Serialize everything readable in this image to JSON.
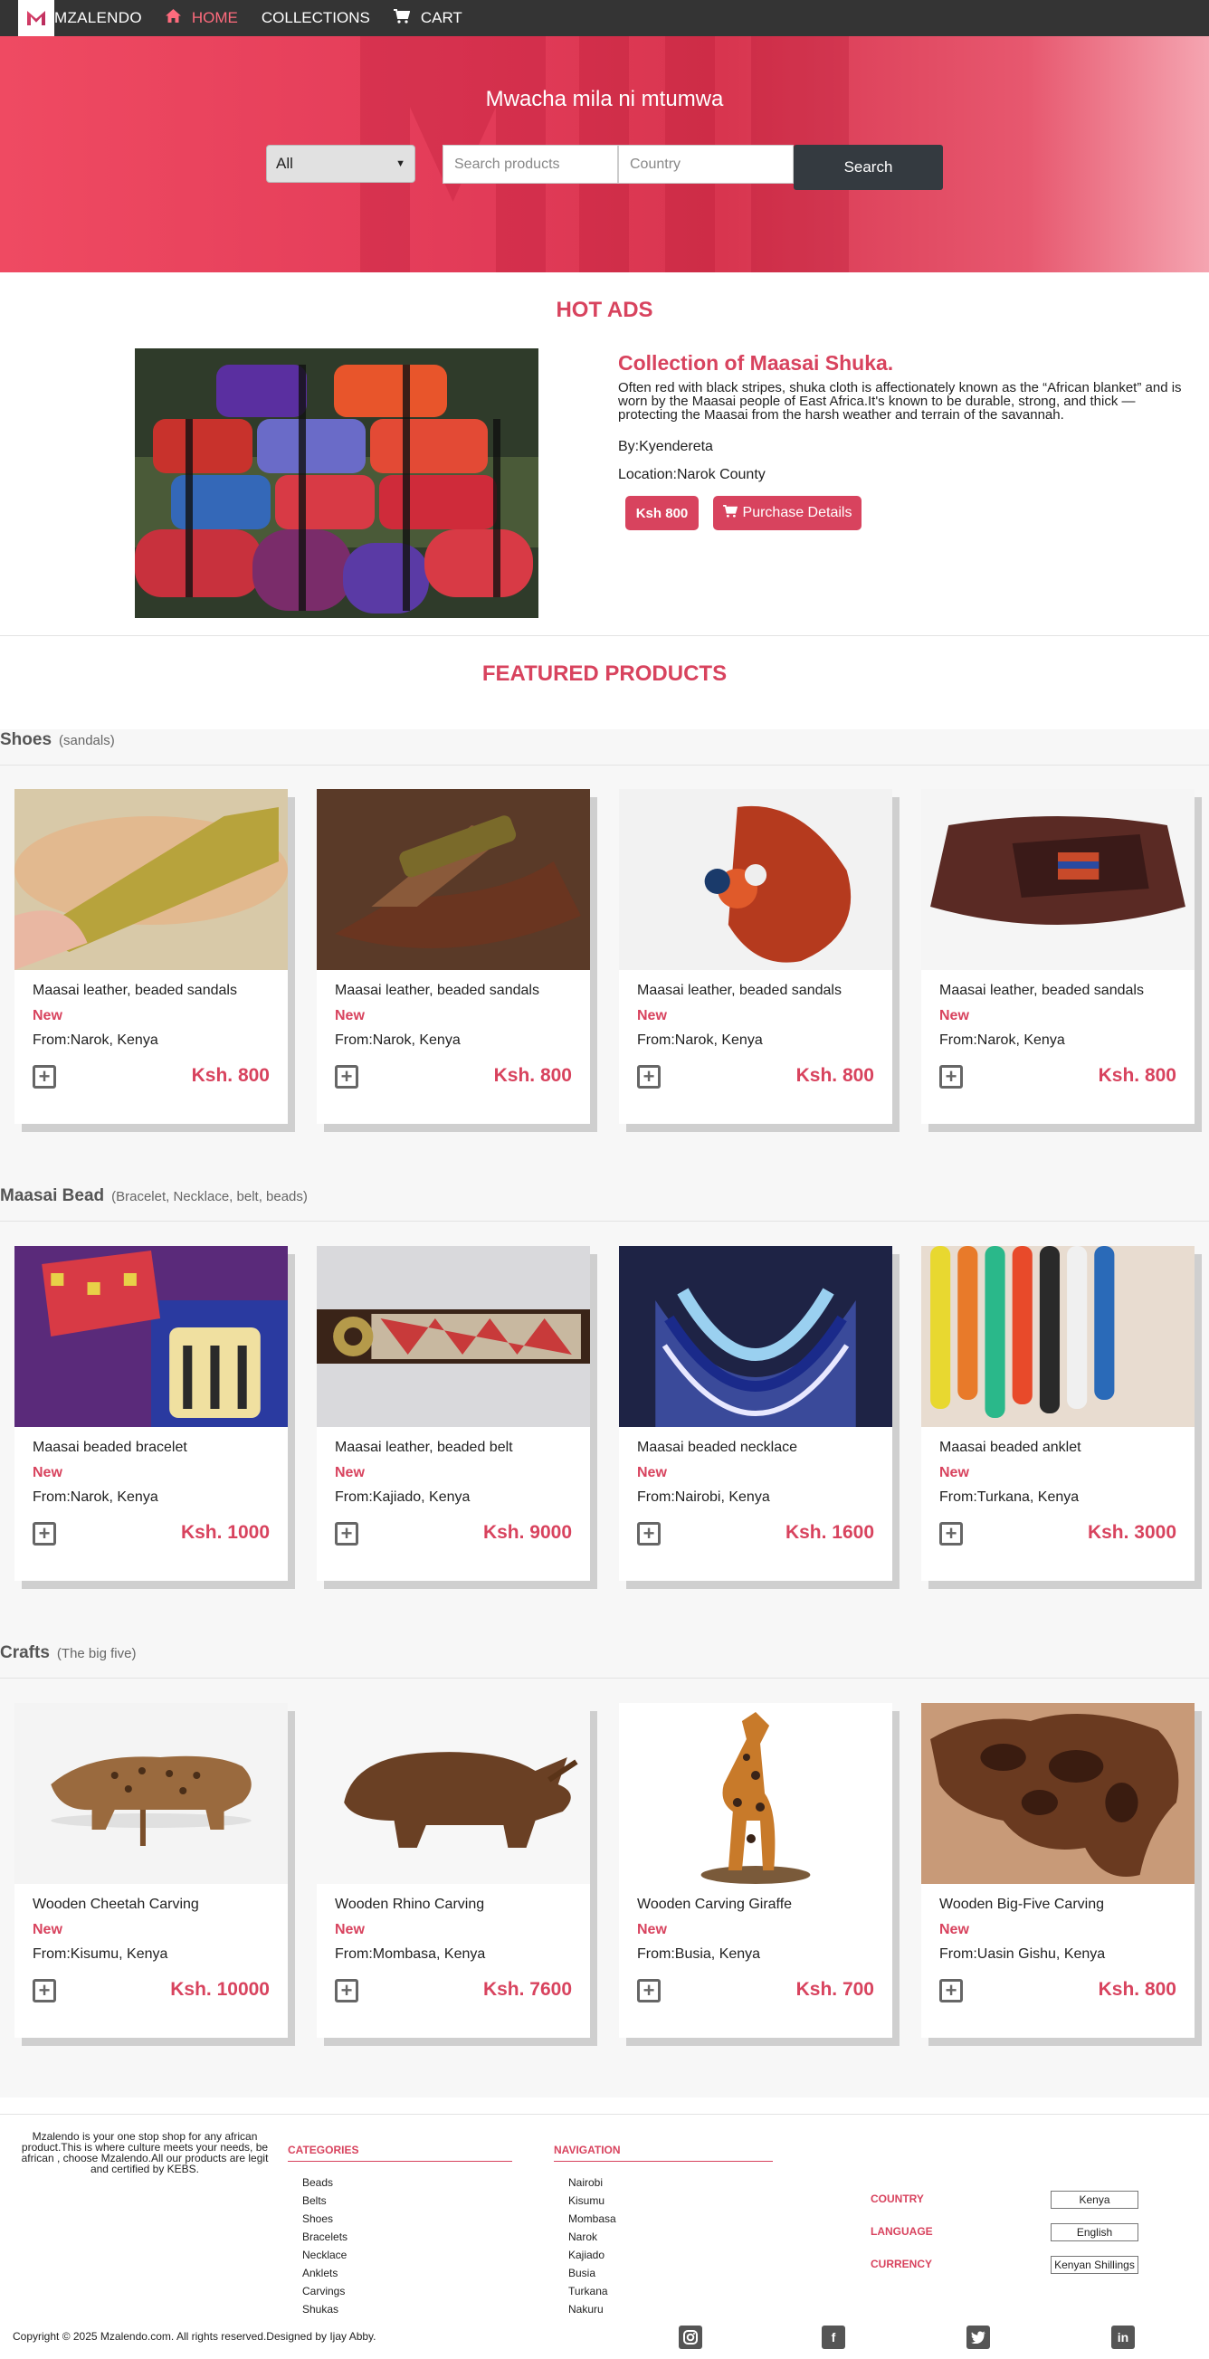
{
  "nav": {
    "brand": "MZALENDO",
    "links": [
      {
        "label": "HOME",
        "icon": "home-icon"
      },
      {
        "label": "COLLECTIONS"
      },
      {
        "label": "CART",
        "icon": "cart-icon"
      }
    ]
  },
  "hero": {
    "title": "Mwacha mila ni mtumwa",
    "category_selected": "All",
    "search_placeholder": "Search products",
    "country_placeholder": "Country",
    "search_button": "Search"
  },
  "hot_ads": {
    "heading": "HOT ADS",
    "title": "Collection of Maasai Shuka.",
    "description": "Often red with black stripes, shuka cloth is affectionately known as the “African blanket” and is worn by the Maasai people of East Africa.It's known to be durable, strong, and thick — protecting the Maasai from the harsh weather and terrain of the savannah.",
    "by": "By:Kyendereta",
    "location": "Location:Narok County",
    "price": "Ksh 800",
    "purchase_button": "Purchase Details"
  },
  "featured_heading": "FEATURED PRODUCTS",
  "categories": [
    {
      "name": "Shoes",
      "sub": "(sandals)",
      "products": [
        {
          "name": "Maasai leather, beaded sandals",
          "badge": "New",
          "from": "From:Narok, Kenya",
          "price": "Ksh. 800"
        },
        {
          "name": "Maasai leather, beaded sandals",
          "badge": "New",
          "from": "From:Narok, Kenya",
          "price": "Ksh. 800"
        },
        {
          "name": "Maasai leather, beaded sandals",
          "badge": "New",
          "from": "From:Narok, Kenya",
          "price": "Ksh. 800"
        },
        {
          "name": "Maasai leather, beaded sandals",
          "badge": "New",
          "from": "From:Narok, Kenya",
          "price": "Ksh. 800"
        }
      ]
    },
    {
      "name": "Maasai Bead",
      "sub": "(Bracelet, Necklace, belt, beads)",
      "products": [
        {
          "name": "Maasai beaded bracelet",
          "badge": "New",
          "from": "From:Narok, Kenya",
          "price": "Ksh. 1000"
        },
        {
          "name": "Maasai leather, beaded belt",
          "badge": "New",
          "from": "From:Kajiado, Kenya",
          "price": "Ksh. 9000"
        },
        {
          "name": "Maasai beaded necklace",
          "badge": "New",
          "from": "From:Nairobi, Kenya",
          "price": "Ksh. 1600"
        },
        {
          "name": "Maasai beaded anklet",
          "badge": "New",
          "from": "From:Turkana, Kenya",
          "price": "Ksh. 3000"
        }
      ]
    },
    {
      "name": "Crafts",
      "sub": "(The big five)",
      "products": [
        {
          "name": "Wooden Cheetah Carving",
          "badge": "New",
          "from": "From:Kisumu, Kenya",
          "price": "Ksh. 10000"
        },
        {
          "name": "Wooden Rhino Carving",
          "badge": "New",
          "from": "From:Mombasa, Kenya",
          "price": "Ksh. 7600"
        },
        {
          "name": "Wooden Carving Giraffe",
          "badge": "New",
          "from": "From:Busia, Kenya",
          "price": "Ksh. 700"
        },
        {
          "name": "Wooden Big-Five Carving",
          "badge": "New",
          "from": "From:Uasin Gishu, Kenya",
          "price": "Ksh. 800"
        }
      ]
    }
  ],
  "footer": {
    "about": "Mzalendo is your one stop shop for any african product.This is where culture meets your needs, be african , choose Mzalendo.All our products are legit and certified by KEBS.",
    "categories_heading": "CATEGORIES",
    "categories": [
      "Beads",
      "Belts",
      "Shoes",
      "Bracelets",
      "Necklace",
      "Anklets",
      "Carvings",
      "Shukas"
    ],
    "navigation_heading": "NAVIGATION",
    "navigation": [
      "Nairobi",
      "Kisumu",
      "Mombasa",
      "Narok",
      "Kajiado",
      "Busia",
      "Turkana",
      "Nakuru"
    ],
    "country_label": "COUNTRY",
    "country_value": "Kenya",
    "language_label": "LANGUAGE",
    "language_value": "English",
    "currency_label": "CURRENCY",
    "currency_value": "Kenyan Shillings",
    "copyright": "Copyright © 2025 Mzalendo.com. All rights reserved.Designed by Ijay Abby.",
    "social": [
      "instagram-icon",
      "facebook-icon",
      "twitter-icon",
      "linkedin-icon"
    ]
  }
}
